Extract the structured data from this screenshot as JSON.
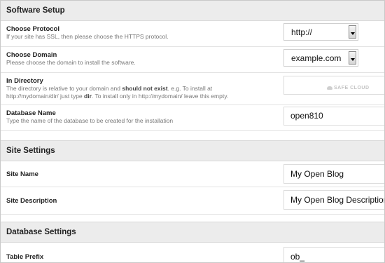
{
  "software_setup": {
    "title": "Software Setup",
    "protocol": {
      "label": "Choose Protocol",
      "desc": "If your site has SSL, then please choose the HTTPS protocol.",
      "value": "http://"
    },
    "domain": {
      "label": "Choose Domain",
      "desc": "Please choose the domain to install the software.",
      "value": "example.com"
    },
    "directory": {
      "label": "In Directory",
      "desc_part1": "The directory is relative to your domain and ",
      "desc_bold1": "should not exist",
      "desc_part2": ". e.g. To install at",
      "desc_line2a": "http://mydomain/dir/ just type ",
      "desc_bold2": "dir",
      "desc_line2b": ". To install only in http://mydomain/ leave this empty.",
      "value": "",
      "watermark": "SAFE CLOUD"
    },
    "database": {
      "label": "Database Name",
      "desc": "Type the name of the database to be created for the installation",
      "value": "open810"
    }
  },
  "site_settings": {
    "title": "Site Settings",
    "site_name": {
      "label": "Site Name",
      "value": "My Open Blog"
    },
    "site_description": {
      "label": "Site Description",
      "value": "My Open Blog Description"
    }
  },
  "database_settings": {
    "title": "Database Settings",
    "table_prefix": {
      "label": "Table Prefix",
      "value": "ob_"
    }
  }
}
